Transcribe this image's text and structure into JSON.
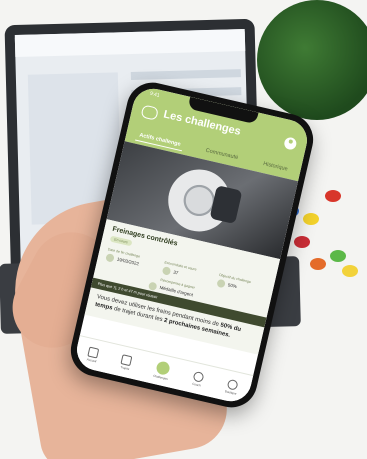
{
  "app": {
    "title": "Les challenges",
    "status_time": "9:41"
  },
  "tabs": [
    {
      "label": "Actifs challenge"
    },
    {
      "label": "Communauté"
    },
    {
      "label": "Historique"
    }
  ],
  "challenge": {
    "title": "Freinages contrôlés",
    "badge": "En cours",
    "col1_label": "Date de fin challenge",
    "col1_value": "19/03/2022",
    "col2_label": "Ecoconduite et usure",
    "col2_value": "37",
    "col3_label": "Objectif du challenge",
    "col3_value": "50%",
    "reward_label": "Récompense à gagner",
    "reward_value": "Médaille d'argent",
    "deadline": "Plus que 7j, 2 h et 47 m pour réussir",
    "desc_prefix": "Vous devez utiliser les freins pendant moins de ",
    "desc_bold1": "50% du temps",
    "desc_mid": " de trajet durant les ",
    "desc_bold2": "2 prochaines semaines."
  },
  "nav": [
    {
      "label": "Accueil",
      "icon": "home-icon"
    },
    {
      "label": "Trajets",
      "icon": "route-icon"
    },
    {
      "label": "Challenges",
      "icon": "leaf-icon"
    },
    {
      "label": "Coach",
      "icon": "coach-icon"
    },
    {
      "label": "Boutique",
      "icon": "shop-icon"
    }
  ]
}
